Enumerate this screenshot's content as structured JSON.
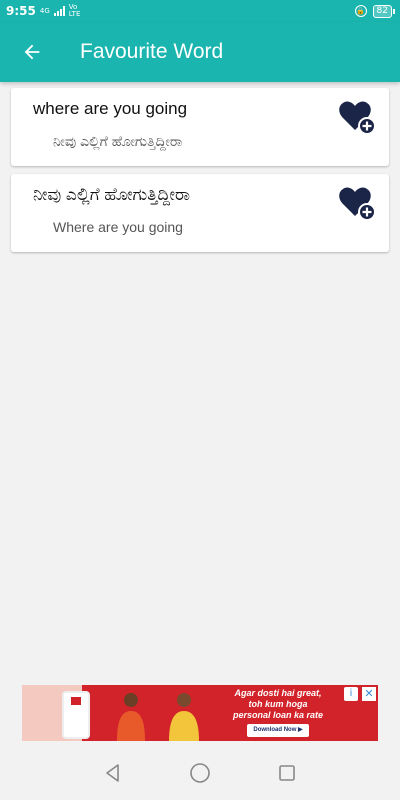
{
  "status_bar": {
    "time": "9:55",
    "network_type": "4G",
    "volte_top": "Vo",
    "volte_bottom": "LTE",
    "battery": "82"
  },
  "app_bar": {
    "title": "Favourite Word",
    "back_icon": "arrow-left-icon",
    "color": "#1ab5ae"
  },
  "favourites": [
    {
      "primary": "where are you going",
      "secondary": "ನೀವು ಎಲ್ಲಿಗೆ ಹೋಗುತ್ತಿದ್ದೀರಾ",
      "action_icon": "heart-add-icon"
    },
    {
      "primary": "ನೀವು ಎಲ್ಲಿಗೆ ಹೋಗುತ್ತಿದ್ದೀರಾ",
      "secondary": "Where are you going",
      "action_icon": "heart-add-icon"
    }
  ],
  "ad": {
    "headline_1": "Agar dosti hai great,",
    "headline_2": "toh kum hoga",
    "headline_3": "personal loan ka rate",
    "cta": "Download Now ▶",
    "info_icon": "info-icon",
    "close_icon": "close-icon"
  },
  "nav_bar": {
    "back_icon": "triangle-back-icon",
    "home_icon": "circle-home-icon",
    "recents_icon": "square-recents-icon"
  },
  "colors": {
    "primary": "#1ab5ae",
    "heart": "#1a2547",
    "background": "#f2f2f2"
  }
}
